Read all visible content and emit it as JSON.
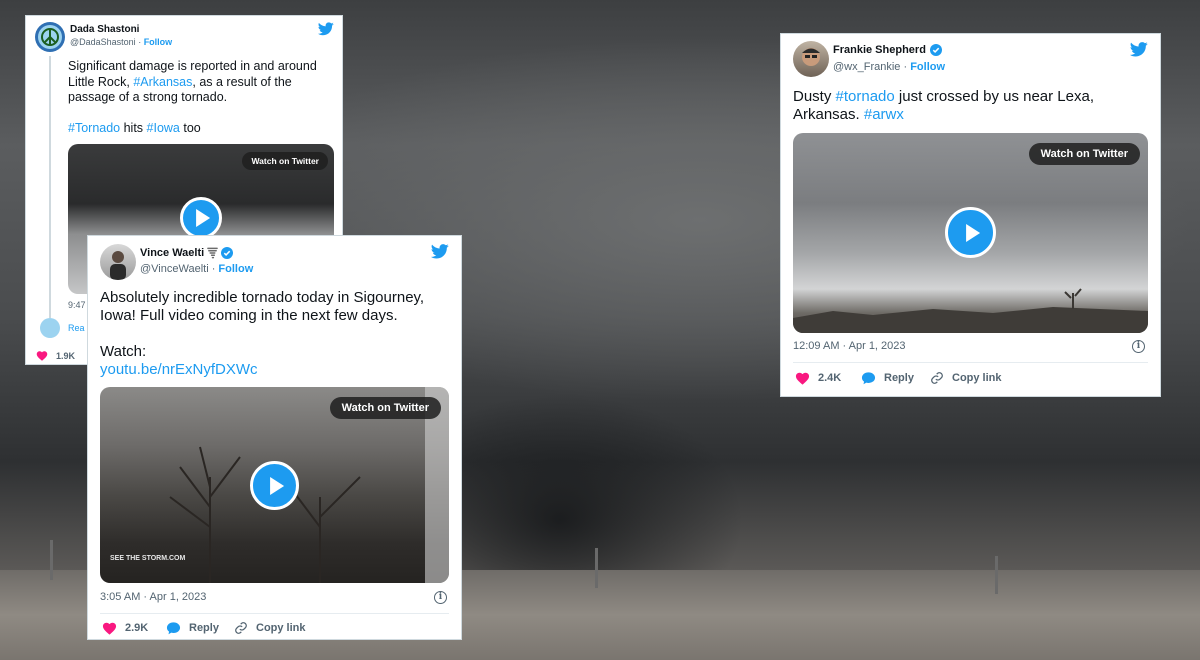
{
  "tweet1": {
    "name": "Dada Shastoni",
    "handle": "@DadaShastoni",
    "follow": "Follow",
    "text_l1": "Significant damage is reported in and around",
    "text_l2a": "Little Rock, ",
    "text_l2_tag": "#Arkansas",
    "text_l2b": ", as a result of the",
    "text_l3": "passage of a strong tornado.",
    "tag_tornado": "#Tornado",
    "hits": " hits ",
    "tag_iowa": "#Iowa",
    "too": " too",
    "watch": "Watch on Twitter",
    "time_partial": "9:47",
    "read_partial": "Rea",
    "likes": "1.9K"
  },
  "tweet2": {
    "name": "Vince Waelti",
    "handle": "@VinceWaelti",
    "follow": "Follow",
    "text_l1": "Absolutely incredible tornado today in Sigourney,",
    "text_l2": "Iowa! Full video coming in the next few days.",
    "watch_label": "Watch:",
    "url": "youtu.be/nrExNyfDXWc",
    "watch": "Watch on Twitter",
    "watermark": "SEE THE STORM.COM",
    "timestamp": "3:05 AM · Apr 1, 2023",
    "likes": "2.9K",
    "reply": "Reply",
    "copy": "Copy link"
  },
  "tweet3": {
    "name": "Frankie Shepherd",
    "handle": "@wx_Frankie",
    "follow": "Follow",
    "text_l1a": "Dusty ",
    "text_l1_tag": "#tornado",
    "text_l1b": " just crossed by us near Lexa,",
    "text_l2a": "Arkansas. ",
    "text_l2_tag": "#arwx",
    "watch": "Watch on Twitter",
    "timestamp": "12:09 AM · Apr 1, 2023",
    "likes": "2.4K",
    "reply": "Reply",
    "copy": "Copy link"
  },
  "colors": {
    "accent": "#1d9bf0",
    "like": "#f91880"
  }
}
